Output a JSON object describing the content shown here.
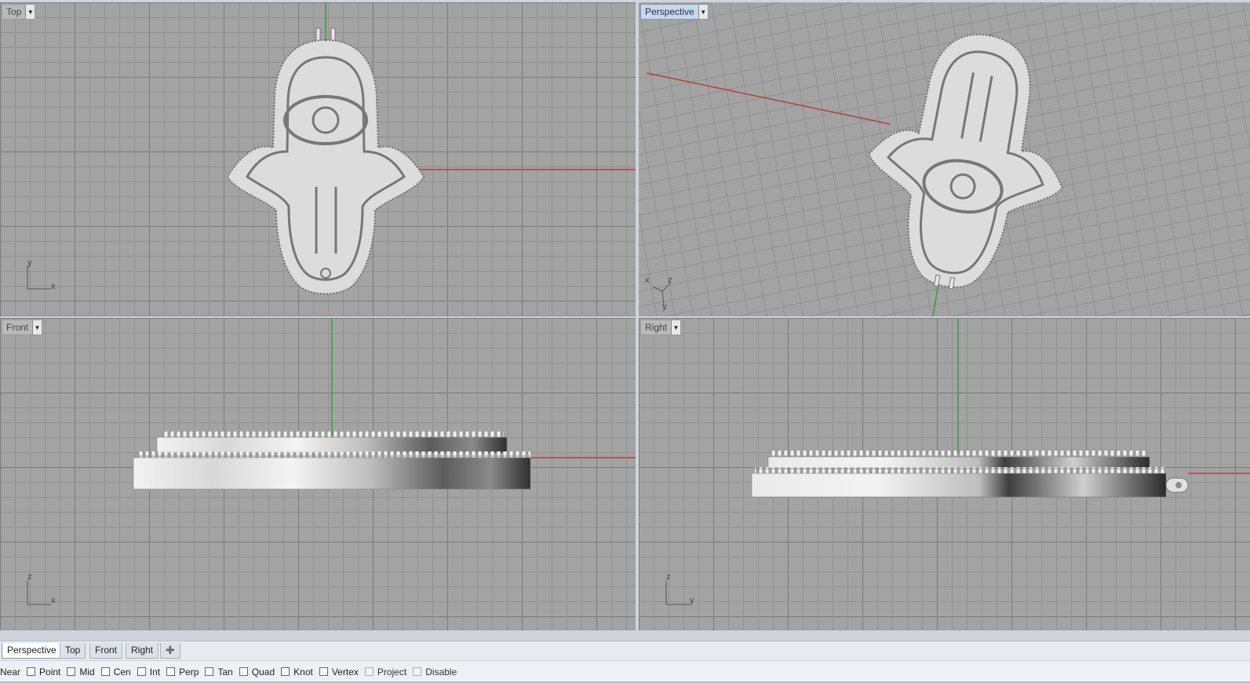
{
  "viewports": {
    "top": {
      "label": "Top",
      "axis_a": "y",
      "axis_b": "x"
    },
    "perspective": {
      "label": "Perspective",
      "axis_a": "x",
      "axis_b": "z",
      "axis_c": "y"
    },
    "front": {
      "label": "Front",
      "axis_a": "z",
      "axis_b": "x"
    },
    "right": {
      "label": "Right",
      "axis_a": "z",
      "axis_b": "y"
    }
  },
  "tabs": [
    "Perspective",
    "Top",
    "Front",
    "Right"
  ],
  "tab_add_symbol": "✚",
  "osnaps": [
    {
      "label": "Near",
      "checked": false
    },
    {
      "label": "Point",
      "checked": false
    },
    {
      "label": "Mid",
      "checked": false
    },
    {
      "label": "Cen",
      "checked": false
    },
    {
      "label": "Int",
      "checked": false
    },
    {
      "label": "Perp",
      "checked": false
    },
    {
      "label": "Tan",
      "checked": false
    },
    {
      "label": "Quad",
      "checked": false
    },
    {
      "label": "Knot",
      "checked": false
    },
    {
      "label": "Vertex",
      "checked": false
    },
    {
      "label": "Project",
      "checked": false
    },
    {
      "label": "Disable",
      "checked": false
    }
  ],
  "colors": {
    "x_axis": "#b04040",
    "y_axis": "#3d9a3d",
    "grid_bg": "#a3a3a3",
    "model": "#e6e6e6",
    "active_tab": "#c9d7ea"
  }
}
